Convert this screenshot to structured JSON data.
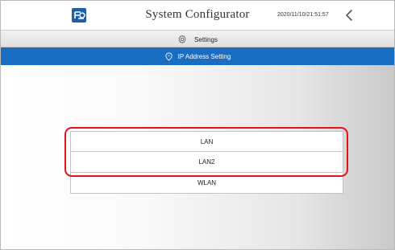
{
  "header": {
    "title": "System Configurator",
    "datetime": "2020/11/10/21:51:57",
    "logo_icon": "brand-logo-icon",
    "back_icon": "chevron-left-icon"
  },
  "settings_bar": {
    "label": "Settings",
    "icon": "gear-icon"
  },
  "section_bar": {
    "label": "IP Address Setting",
    "icon": "network-pin-icon",
    "color": "#1a6ec2"
  },
  "network_options": [
    {
      "label": "LAN"
    },
    {
      "label": "LAN2"
    },
    {
      "label": "WLAN"
    }
  ],
  "highlight_color": "#e4131b"
}
